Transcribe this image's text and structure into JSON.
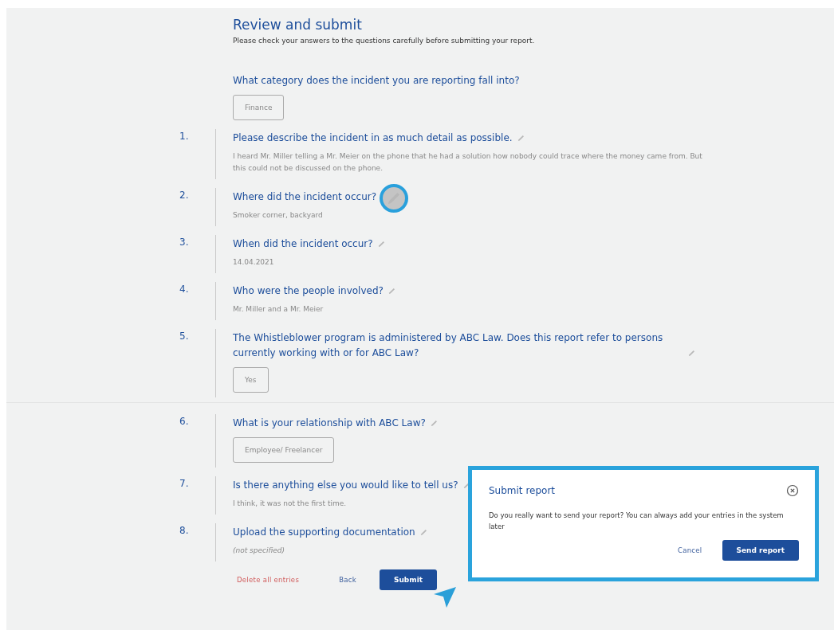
{
  "header": {
    "title": "Review and submit",
    "subtitle": "Please check your answers to the questions carefully before submitting your report."
  },
  "category": {
    "question": "What category does the incident you are reporting fall into?",
    "answer": "Finance"
  },
  "questions": [
    {
      "number": "1.",
      "question": "Please describe the incident in as much detail as possible.",
      "kind": "text",
      "answer": "I heard Mr. Miller telling a Mr. Meier on the phone that he had a solution how nobody could trace where the money came from. But this could not be discussed on the phone.",
      "edit_highlighted": false
    },
    {
      "number": "2.",
      "question": "Where did the incident occur?",
      "kind": "text",
      "answer": "Smoker corner, backyard",
      "edit_highlighted": true
    },
    {
      "number": "3.",
      "question": "When did the incident occur?",
      "kind": "text",
      "answer": "14.04.2021",
      "edit_highlighted": false
    },
    {
      "number": "4.",
      "question": "Who were the people involved?",
      "kind": "text",
      "answer": "Mr. Miller and a Mr. Meier",
      "edit_highlighted": false
    },
    {
      "number": "5.",
      "question": "The Whistleblower program is administered by ABC Law. Does this report refer to persons currently working with or for ABC Law?",
      "kind": "chip",
      "answer": "Yes",
      "edit_highlighted": false
    },
    {
      "number": "6.",
      "question": "What is your relationship with ABC Law?",
      "kind": "chip",
      "answer": "Employee/ Freelancer",
      "edit_highlighted": false
    },
    {
      "number": "7.",
      "question": "Is there anything else you would like to tell us?",
      "kind": "text",
      "answer": "I think, it was not the first time.",
      "edit_highlighted": false
    },
    {
      "number": "8.",
      "question": "Upload the supporting documentation",
      "kind": "empty",
      "answer": "(not specified)",
      "edit_highlighted": false
    }
  ],
  "actions": {
    "delete": "Delete all entries",
    "back": "Back",
    "submit": "Submit"
  },
  "dialog": {
    "title": "Submit report",
    "message": "Do you really want to send your report? You can always add your entries in the system later",
    "cancel": "Cancel",
    "confirm": "Send report"
  }
}
